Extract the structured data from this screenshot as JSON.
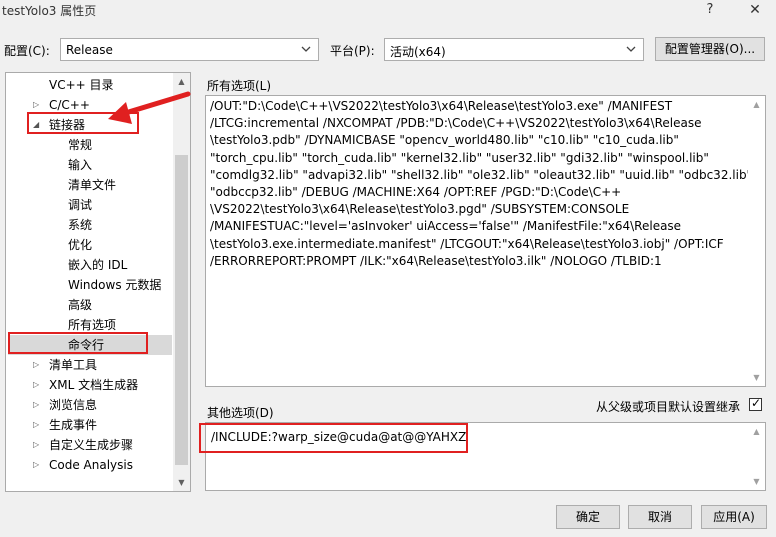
{
  "window": {
    "title": "testYolo3 属性页",
    "help_label": "?",
    "close_label": "✕"
  },
  "toolbar": {
    "config_label": "配置(C):",
    "config_value": "Release",
    "platform_label": "平台(P):",
    "platform_value": "活动(x64)",
    "config_manager_label": "配置管理器(O)..."
  },
  "tree": {
    "items": [
      {
        "label": "VC++ 目录",
        "level": 1,
        "expander": ""
      },
      {
        "label": "C/C++",
        "level": 0,
        "expander": "collapsed"
      },
      {
        "label": "链接器",
        "level": 0,
        "expander": "expanded"
      },
      {
        "label": "常规",
        "level": 2,
        "expander": ""
      },
      {
        "label": "输入",
        "level": 2,
        "expander": ""
      },
      {
        "label": "清单文件",
        "level": 2,
        "expander": ""
      },
      {
        "label": "调试",
        "level": 2,
        "expander": ""
      },
      {
        "label": "系统",
        "level": 2,
        "expander": ""
      },
      {
        "label": "优化",
        "level": 2,
        "expander": ""
      },
      {
        "label": "嵌入的 IDL",
        "level": 2,
        "expander": ""
      },
      {
        "label": "Windows 元数据",
        "level": 2,
        "expander": ""
      },
      {
        "label": "高级",
        "level": 2,
        "expander": ""
      },
      {
        "label": "所有选项",
        "level": 2,
        "expander": ""
      },
      {
        "label": "命令行",
        "level": 2,
        "expander": "",
        "selected": true
      },
      {
        "label": "清单工具",
        "level": 0,
        "expander": "collapsed"
      },
      {
        "label": "XML 文档生成器",
        "level": 0,
        "expander": "collapsed"
      },
      {
        "label": "浏览信息",
        "level": 0,
        "expander": "collapsed"
      },
      {
        "label": "生成事件",
        "level": 0,
        "expander": "collapsed"
      },
      {
        "label": "自定义生成步骤",
        "level": 0,
        "expander": "collapsed"
      },
      {
        "label": "Code Analysis",
        "level": 0,
        "expander": "collapsed"
      }
    ]
  },
  "all_options": {
    "label": "所有选项(L)",
    "lines": [
      "/OUT:\"D:\\Code\\C++\\VS2022\\testYolo3\\x64\\Release\\testYolo3.exe\" /MANIFEST",
      "/LTCG:incremental /NXCOMPAT /PDB:\"D:\\Code\\C++\\VS2022\\testYolo3\\x64\\Release",
      "\\testYolo3.pdb\" /DYNAMICBASE \"opencv_world480.lib\" \"c10.lib\" \"c10_cuda.lib\"",
      "\"torch_cpu.lib\" \"torch_cuda.lib\" \"kernel32.lib\" \"user32.lib\" \"gdi32.lib\" \"winspool.lib\"",
      "\"comdlg32.lib\" \"advapi32.lib\" \"shell32.lib\" \"ole32.lib\" \"oleaut32.lib\" \"uuid.lib\" \"odbc32.lib\"",
      "\"odbccp32.lib\" /DEBUG /MACHINE:X64 /OPT:REF /PGD:\"D:\\Code\\C++",
      "\\VS2022\\testYolo3\\x64\\Release\\testYolo3.pgd\" /SUBSYSTEM:CONSOLE",
      "/MANIFESTUAC:\"level='asInvoker' uiAccess='false'\" /ManifestFile:\"x64\\Release",
      "\\testYolo3.exe.intermediate.manifest\" /LTCGOUT:\"x64\\Release\\testYolo3.iobj\" /OPT:ICF",
      "/ERRORREPORT:PROMPT /ILK:\"x64\\Release\\testYolo3.ilk\" /NOLOGO /TLBID:1"
    ]
  },
  "other_options": {
    "label": "其他选项(D)",
    "inherit_label": "从父级或项目默认设置继承",
    "inherit_checked": true,
    "value": "/INCLUDE:?warp_size@cuda@at@@YAHXZ"
  },
  "footer": {
    "ok_label": "确定",
    "cancel_label": "取消",
    "apply_label": "应用(A)"
  },
  "colors": {
    "highlight": "#e02020",
    "selected_bg": "#d9d9d9"
  }
}
